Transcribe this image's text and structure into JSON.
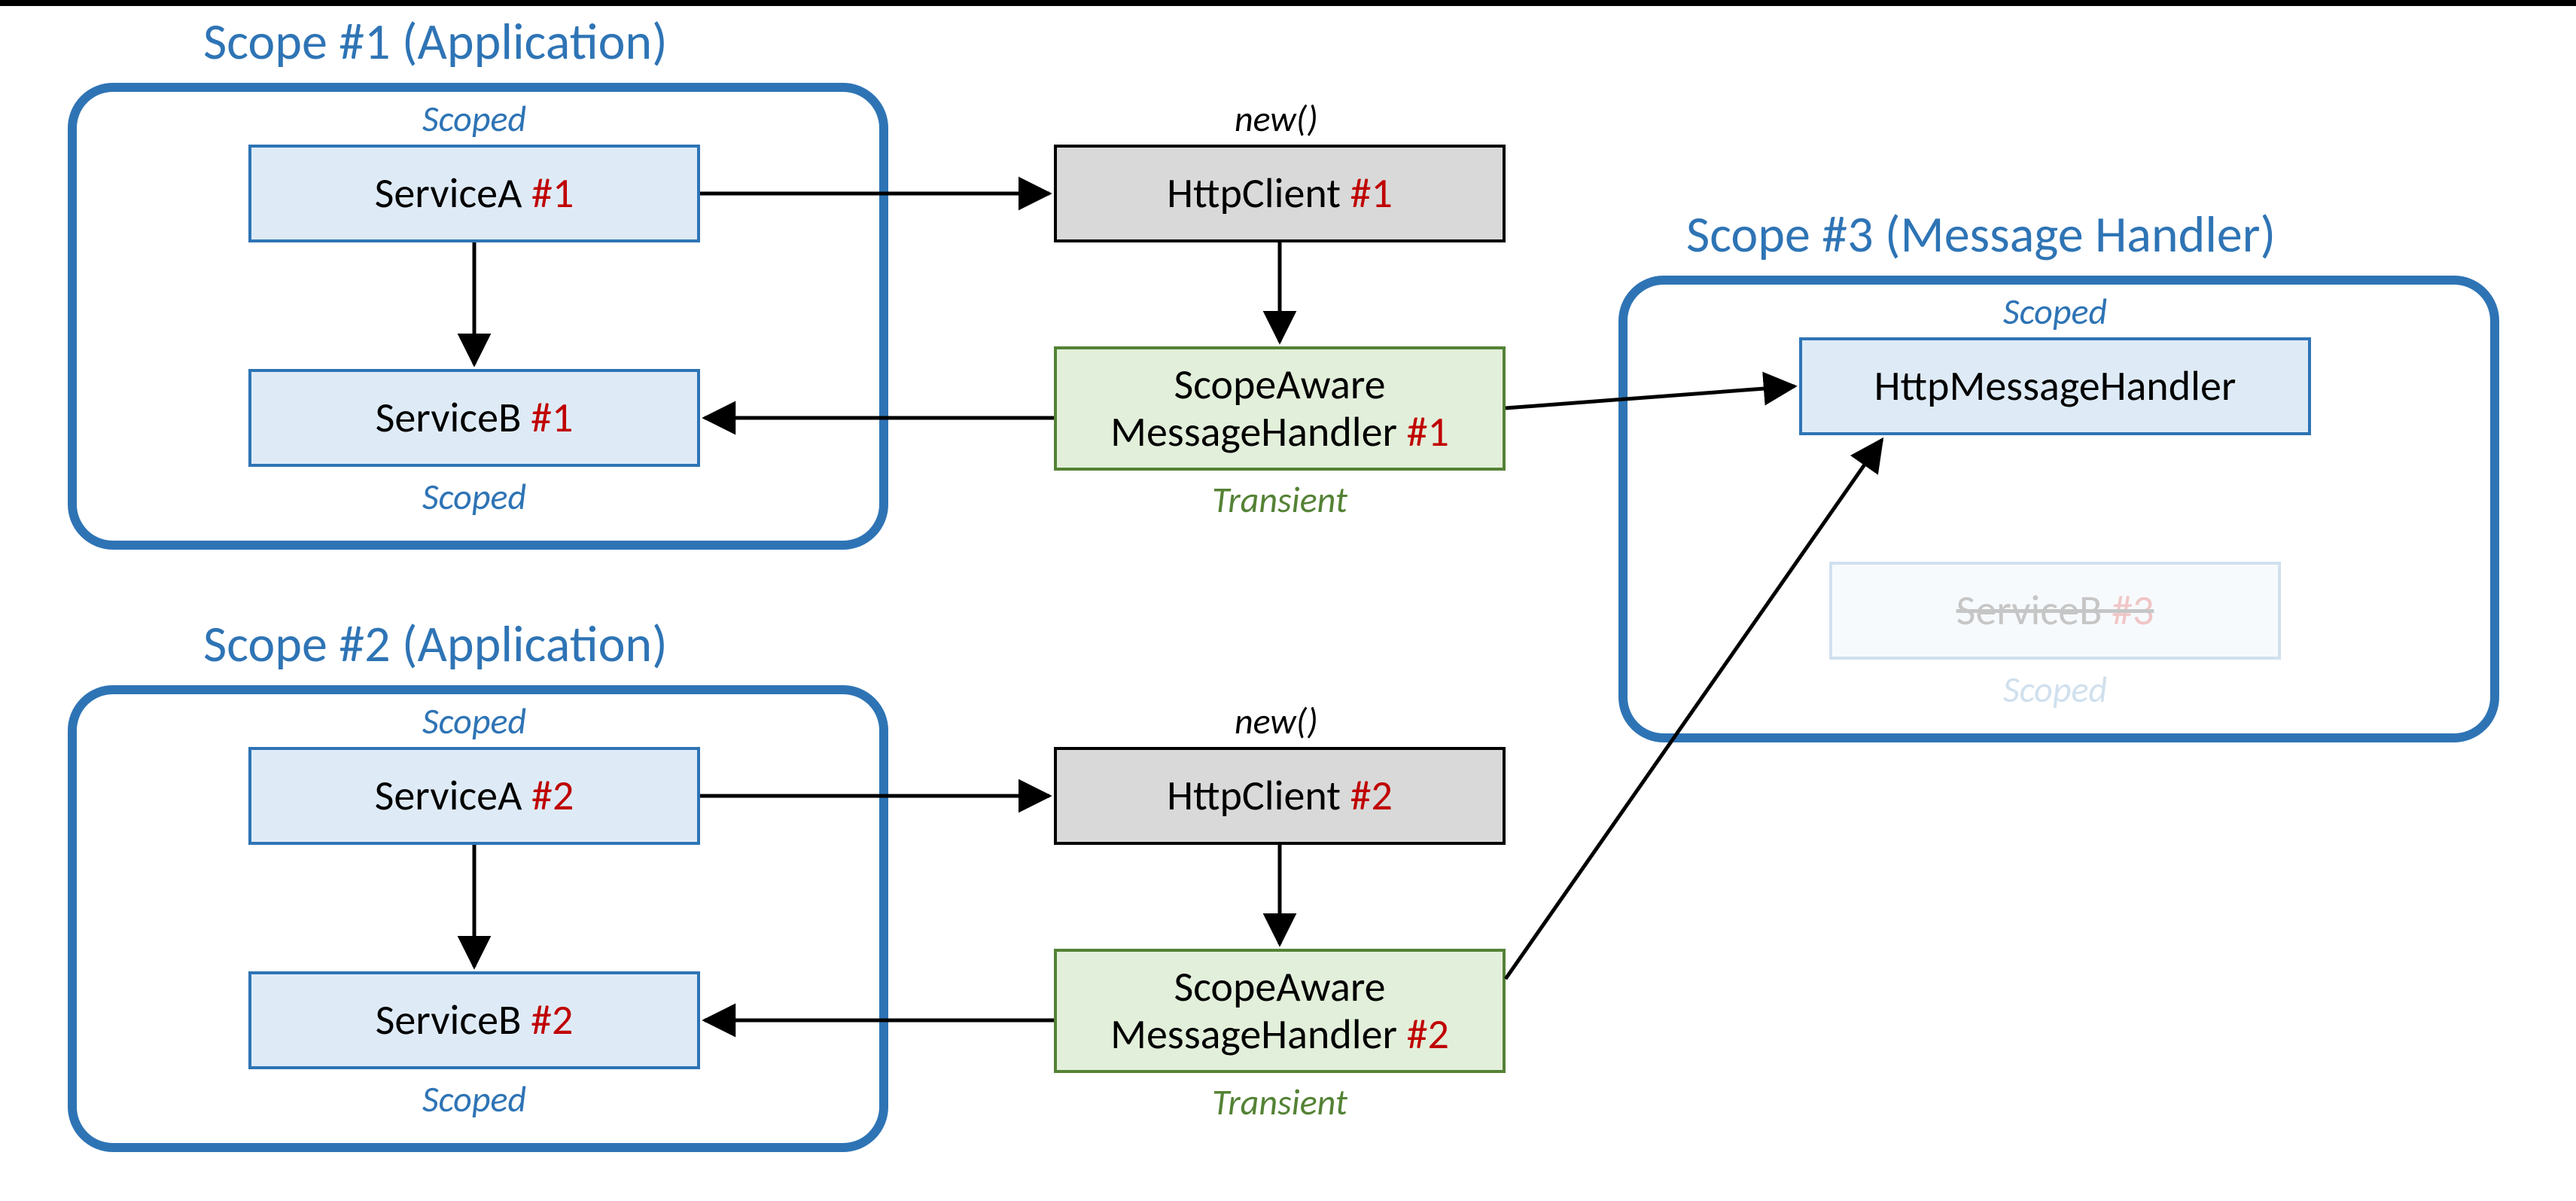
{
  "scopes": {
    "s1": {
      "title": "Scope #1 (Application)"
    },
    "s2": {
      "title": "Scope #2 (Application)"
    },
    "s3": {
      "title": "Scope #3 (Message Handler)"
    }
  },
  "labels": {
    "scoped": "Scoped",
    "transient": "Transient",
    "newcall": "new()"
  },
  "boxes": {
    "svcA1": {
      "text": "ServiceA ",
      "num": "#1"
    },
    "svcB1": {
      "text": "ServiceB ",
      "num": "#1"
    },
    "svcA2": {
      "text": "ServiceA ",
      "num": "#2"
    },
    "svcB2": {
      "text": "ServiceB ",
      "num": "#2"
    },
    "http1": {
      "text": "HttpClient ",
      "num": "#1"
    },
    "http2": {
      "text": "HttpClient ",
      "num": "#2"
    },
    "samh1": {
      "line1": "ScopeAware",
      "line2a": "MessageHandler ",
      "num": "#1"
    },
    "samh2": {
      "line1": "ScopeAware",
      "line2a": "MessageHandler ",
      "num": "#2"
    },
    "hmh": {
      "text": "HttpMessageHandler"
    },
    "svcB3": {
      "text": "ServiceB ",
      "num": "#3"
    }
  },
  "chart_data": {
    "type": "diagram",
    "nodes": [
      {
        "id": "scope1",
        "kind": "scope",
        "label": "Scope #1 (Application)"
      },
      {
        "id": "scope2",
        "kind": "scope",
        "label": "Scope #2 (Application)"
      },
      {
        "id": "scope3",
        "kind": "scope",
        "label": "Scope #3 (Message Handler)"
      },
      {
        "id": "ServiceA#1",
        "kind": "service",
        "scope": "scope1",
        "lifetime": "Scoped"
      },
      {
        "id": "ServiceB#1",
        "kind": "service",
        "scope": "scope1",
        "lifetime": "Scoped"
      },
      {
        "id": "ServiceA#2",
        "kind": "service",
        "scope": "scope2",
        "lifetime": "Scoped"
      },
      {
        "id": "ServiceB#2",
        "kind": "service",
        "scope": "scope2",
        "lifetime": "Scoped"
      },
      {
        "id": "HttpClient#1",
        "kind": "httpclient",
        "lifetime": "new()"
      },
      {
        "id": "HttpClient#2",
        "kind": "httpclient",
        "lifetime": "new()"
      },
      {
        "id": "ScopeAwareMessageHandler#1",
        "kind": "handler",
        "lifetime": "Transient"
      },
      {
        "id": "ScopeAwareMessageHandler#2",
        "kind": "handler",
        "lifetime": "Transient"
      },
      {
        "id": "HttpMessageHandler",
        "kind": "handler",
        "scope": "scope3",
        "lifetime": "Scoped"
      },
      {
        "id": "ServiceB#3",
        "kind": "service",
        "scope": "scope3",
        "lifetime": "Scoped",
        "suppressed": true
      }
    ],
    "edges": [
      {
        "from": "ServiceA#1",
        "to": "HttpClient#1"
      },
      {
        "from": "ServiceA#1",
        "to": "ServiceB#1"
      },
      {
        "from": "HttpClient#1",
        "to": "ScopeAwareMessageHandler#1"
      },
      {
        "from": "ScopeAwareMessageHandler#1",
        "to": "ServiceB#1"
      },
      {
        "from": "ScopeAwareMessageHandler#1",
        "to": "HttpMessageHandler"
      },
      {
        "from": "ServiceA#2",
        "to": "HttpClient#2"
      },
      {
        "from": "ServiceA#2",
        "to": "ServiceB#2"
      },
      {
        "from": "HttpClient#2",
        "to": "ScopeAwareMessageHandler#2"
      },
      {
        "from": "ScopeAwareMessageHandler#2",
        "to": "ServiceB#2"
      },
      {
        "from": "ScopeAwareMessageHandler#2",
        "to": "HttpMessageHandler"
      }
    ]
  }
}
